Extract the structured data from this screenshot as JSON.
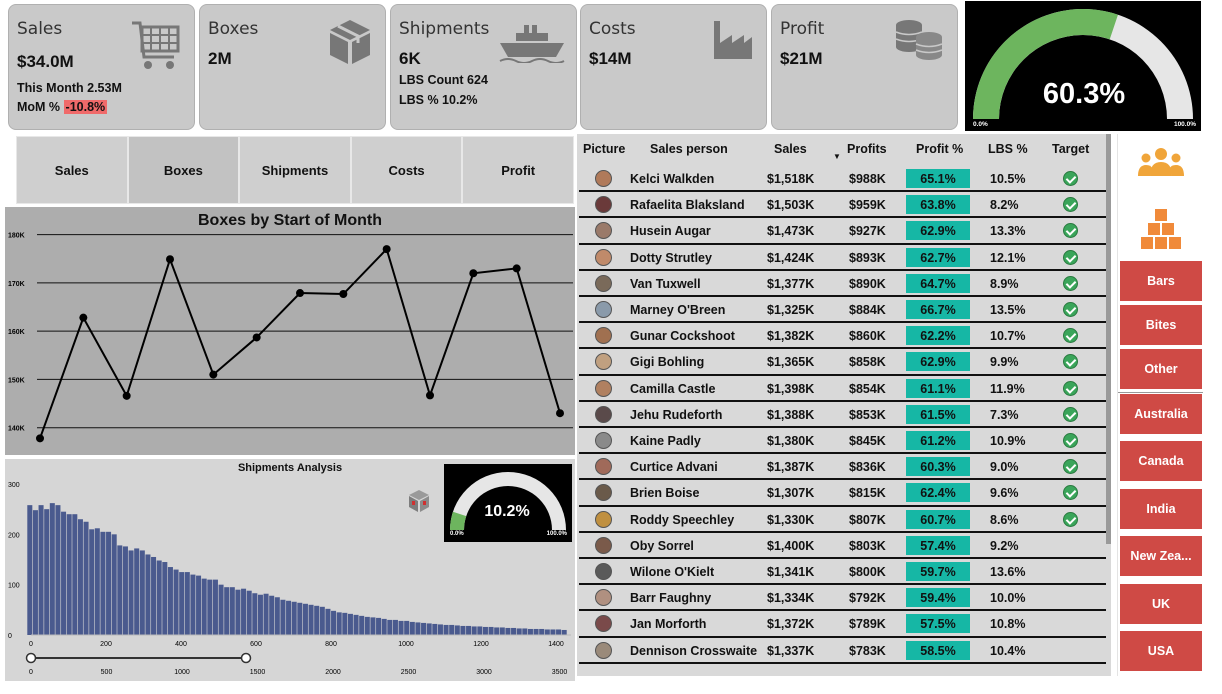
{
  "kpis": {
    "sales": {
      "title": "Sales",
      "value": "$34.0M",
      "this_month": "This Month 2.53M",
      "mom_label": "MoM %",
      "mom_value": "-10.8%"
    },
    "boxes": {
      "title": "Boxes",
      "value": "2M"
    },
    "shipments": {
      "title": "Shipments",
      "value": "6K",
      "lbs_count": "LBS Count 624",
      "lbs_pct": "LBS % 10.2%"
    },
    "costs": {
      "title": "Costs",
      "value": "$14M"
    },
    "profit": {
      "title": "Profit",
      "value": "$21M"
    }
  },
  "top_gauge": {
    "value": "60.3%",
    "fraction": 0.603,
    "min": "0.0%",
    "max": "100.0%",
    "fill_color": "#6db55e",
    "track_color": "#e6e6e6"
  },
  "tabs": [
    {
      "label": "Sales"
    },
    {
      "label": "Boxes"
    },
    {
      "label": "Shipments"
    },
    {
      "label": "Costs"
    },
    {
      "label": "Profit"
    }
  ],
  "line_chart": {
    "title": "Boxes by Start of Month",
    "y_ticks": [
      "180K",
      "170K",
      "160K",
      "150K",
      "140K"
    ]
  },
  "histogram": {
    "title": "Shipments Analysis",
    "y_ticks": [
      "300",
      "200",
      "100",
      "0"
    ],
    "x_ticks": [
      "0",
      "200",
      "400",
      "600",
      "800",
      "1000",
      "1200",
      "1400"
    ],
    "slider_ticks": [
      "0",
      "500",
      "1000",
      "1500",
      "2000",
      "2500",
      "3000",
      "3500"
    ]
  },
  "hist_gauge": {
    "value": "10.2%",
    "fraction": 0.102,
    "min": "0.0%",
    "max": "100.0%"
  },
  "table": {
    "headers": {
      "picture": "Picture",
      "salesperson": "Sales person",
      "sales": "Sales",
      "profits": "Profits",
      "profit_pct": "Profit %",
      "lbs_pct": "LBS %",
      "target": "Target"
    },
    "rows": [
      {
        "name": "Kelci Walkden",
        "sales": "$1,518K",
        "profits": "$988K",
        "profit_pct": "65.1%",
        "lbs": "10.5%",
        "target": true
      },
      {
        "name": "Rafaelita Blaksland",
        "sales": "$1,503K",
        "profits": "$959K",
        "profit_pct": "63.8%",
        "lbs": "8.2%",
        "target": true
      },
      {
        "name": "Husein Augar",
        "sales": "$1,473K",
        "profits": "$927K",
        "profit_pct": "62.9%",
        "lbs": "13.3%",
        "target": true
      },
      {
        "name": "Dotty Strutley",
        "sales": "$1,424K",
        "profits": "$893K",
        "profit_pct": "62.7%",
        "lbs": "12.1%",
        "target": true
      },
      {
        "name": "Van Tuxwell",
        "sales": "$1,377K",
        "profits": "$890K",
        "profit_pct": "64.7%",
        "lbs": "8.9%",
        "target": true
      },
      {
        "name": "Marney O'Breen",
        "sales": "$1,325K",
        "profits": "$884K",
        "profit_pct": "66.7%",
        "lbs": "13.5%",
        "target": true
      },
      {
        "name": "Gunar Cockshoot",
        "sales": "$1,382K",
        "profits": "$860K",
        "profit_pct": "62.2%",
        "lbs": "10.7%",
        "target": true
      },
      {
        "name": "Gigi Bohling",
        "sales": "$1,365K",
        "profits": "$858K",
        "profit_pct": "62.9%",
        "lbs": "9.9%",
        "target": true
      },
      {
        "name": "Camilla Castle",
        "sales": "$1,398K",
        "profits": "$854K",
        "profit_pct": "61.1%",
        "lbs": "11.9%",
        "target": true
      },
      {
        "name": "Jehu Rudeforth",
        "sales": "$1,388K",
        "profits": "$853K",
        "profit_pct": "61.5%",
        "lbs": "7.3%",
        "target": true
      },
      {
        "name": "Kaine Padly",
        "sales": "$1,380K",
        "profits": "$845K",
        "profit_pct": "61.2%",
        "lbs": "10.9%",
        "target": true
      },
      {
        "name": "Curtice Advani",
        "sales": "$1,387K",
        "profits": "$836K",
        "profit_pct": "60.3%",
        "lbs": "9.0%",
        "target": true
      },
      {
        "name": "Brien Boise",
        "sales": "$1,307K",
        "profits": "$815K",
        "profit_pct": "62.4%",
        "lbs": "9.6%",
        "target": true
      },
      {
        "name": "Roddy Speechley",
        "sales": "$1,330K",
        "profits": "$807K",
        "profit_pct": "60.7%",
        "lbs": "8.6%",
        "target": true
      },
      {
        "name": "Oby Sorrel",
        "sales": "$1,400K",
        "profits": "$803K",
        "profit_pct": "57.4%",
        "lbs": "9.2%",
        "target": false
      },
      {
        "name": "Wilone O'Kielt",
        "sales": "$1,341K",
        "profits": "$800K",
        "profit_pct": "59.7%",
        "lbs": "13.6%",
        "target": false
      },
      {
        "name": "Barr Faughny",
        "sales": "$1,334K",
        "profits": "$792K",
        "profit_pct": "59.4%",
        "lbs": "10.0%",
        "target": false
      },
      {
        "name": "Jan Morforth",
        "sales": "$1,372K",
        "profits": "$789K",
        "profit_pct": "57.5%",
        "lbs": "10.8%",
        "target": false
      },
      {
        "name": "Dennison Crosswaite",
        "sales": "$1,337K",
        "profits": "$783K",
        "profit_pct": "58.5%",
        "lbs": "10.4%",
        "target": false
      }
    ]
  },
  "slicer": {
    "icons": [
      "people-icon",
      "boxes-icon"
    ],
    "products": [
      {
        "label": "Bars"
      },
      {
        "label": "Bites"
      },
      {
        "label": "Other"
      }
    ],
    "countries": [
      {
        "label": "Australia"
      },
      {
        "label": "Canada"
      },
      {
        "label": "India"
      },
      {
        "label": "New Zea..."
      },
      {
        "label": "UK"
      },
      {
        "label": "USA"
      }
    ]
  },
  "colors": {
    "accent_red": "#cf4a45",
    "teal": "#16b7a5",
    "gauge_green": "#6db55e",
    "bar_blue": "#4a5a8e",
    "icon_orange": "#f0a53a"
  },
  "chart_data": [
    {
      "type": "line",
      "title": "Boxes by Start of Month",
      "xlabel": "",
      "ylabel": "",
      "x": [
        1,
        2,
        3,
        4,
        5,
        6,
        7,
        8,
        9,
        10,
        11,
        12,
        13
      ],
      "values": [
        137800,
        162800,
        146600,
        174900,
        151000,
        158700,
        167900,
        167700,
        177000,
        146700,
        172000,
        173000,
        143000
      ],
      "ylim": [
        136000,
        182000
      ],
      "y_ticks": [
        140000,
        150000,
        160000,
        170000,
        180000
      ],
      "grid": true
    },
    {
      "type": "bar",
      "title": "Shipments Analysis",
      "xlabel": "",
      "ylabel": "",
      "xlim": [
        0,
        1440
      ],
      "ylim": [
        0,
        300
      ],
      "bin_width": 15,
      "values": [
        258,
        248,
        258,
        250,
        262,
        258,
        245,
        240,
        240,
        230,
        225,
        210,
        212,
        205,
        205,
        200,
        178,
        176,
        168,
        172,
        168,
        160,
        155,
        148,
        145,
        135,
        130,
        125,
        125,
        120,
        118,
        112,
        110,
        110,
        100,
        95,
        95,
        90,
        92,
        88,
        83,
        80,
        82,
        78,
        75,
        70,
        68,
        66,
        64,
        62,
        60,
        58,
        56,
        52,
        48,
        45,
        44,
        42,
        40,
        38,
        36,
        35,
        34,
        32,
        30,
        30,
        28,
        28,
        26,
        25,
        24,
        23,
        22,
        21,
        20,
        20,
        19,
        18,
        18,
        17,
        17,
        16,
        16,
        15,
        15,
        14,
        14,
        13,
        13,
        12,
        12,
        12,
        11,
        11,
        11,
        10
      ],
      "grid": false
    }
  ]
}
